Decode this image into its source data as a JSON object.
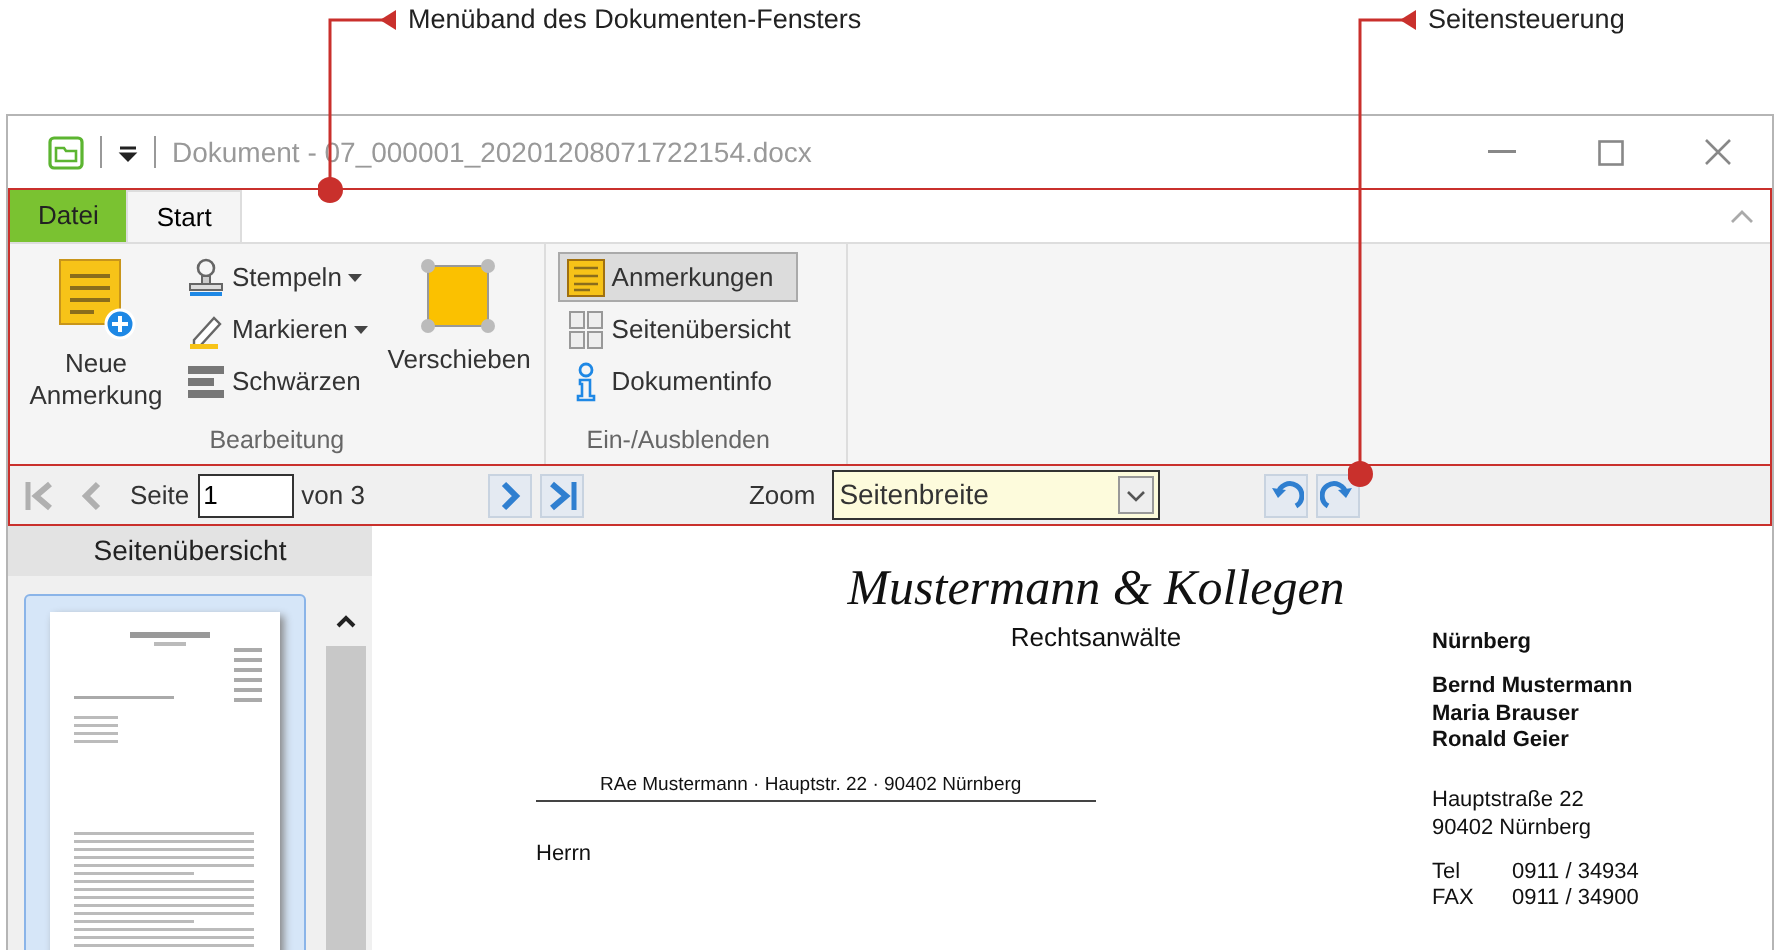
{
  "callouts": [
    {
      "label": "Menüband des Dokumenten-Fensters"
    },
    {
      "label": "Seitensteuerung"
    }
  ],
  "window": {
    "title": "Dokument - 07_000001_20201208071722154.docx"
  },
  "ribbon_tabs": [
    {
      "label": "Datei",
      "kind": "file",
      "selected": false
    },
    {
      "label": "Start",
      "kind": "tab",
      "selected": true
    }
  ],
  "ribbon_groups": [
    {
      "label": "Bearbeitung",
      "items": [
        {
          "label": "Neue Anmerkung",
          "kind": "large"
        },
        {
          "label": "Stempeln",
          "kind": "dropdown"
        },
        {
          "label": "Markieren",
          "kind": "dropdown"
        },
        {
          "label": "Schwärzen",
          "kind": "small"
        },
        {
          "label": "Verschieben",
          "kind": "large"
        }
      ]
    },
    {
      "label": "Ein-/Ausblenden",
      "items": [
        {
          "label": "Anmerkungen",
          "kind": "toggle",
          "selected": true
        },
        {
          "label": "Seitenübersicht",
          "kind": "toggle",
          "selected": false
        },
        {
          "label": "Dokumentinfo",
          "kind": "toggle",
          "selected": false
        }
      ]
    }
  ],
  "page_nav": {
    "buttons": [
      {
        "kind": "first",
        "disabled": true
      },
      {
        "kind": "prev",
        "disabled": true
      },
      {
        "kind": "next",
        "disabled": false
      },
      {
        "kind": "last",
        "disabled": false
      }
    ],
    "page_label": "Seite",
    "page_value": "1",
    "page_total": "von 3",
    "zoom_label": "Zoom",
    "zoom_value": "Seitenbreite",
    "rotate_buttons": [
      {
        "kind": "left"
      },
      {
        "kind": "right"
      }
    ]
  },
  "sidebar": {
    "title": "Seitenübersicht",
    "thumbnails": [
      {
        "selected": true
      }
    ]
  },
  "document": {
    "firm": "Mustermann & Kollegen",
    "subtitle": "Rechtsanwälte",
    "sender_line": "RAe Mustermann · Hauptstr. 22 · 90402 Nürnberg",
    "recipient": "Herrn",
    "city": "Nürnberg",
    "partners": [
      "Bernd Mustermann",
      "Maria Brauser",
      "Ronald Geier"
    ],
    "address": [
      "Hauptstraße 22",
      "90402 Nürnberg"
    ],
    "contacts": [
      {
        "label": "Tel",
        "value": "0911 / 34934"
      },
      {
        "label": "FAX",
        "value": "0911 / 34900"
      }
    ]
  }
}
